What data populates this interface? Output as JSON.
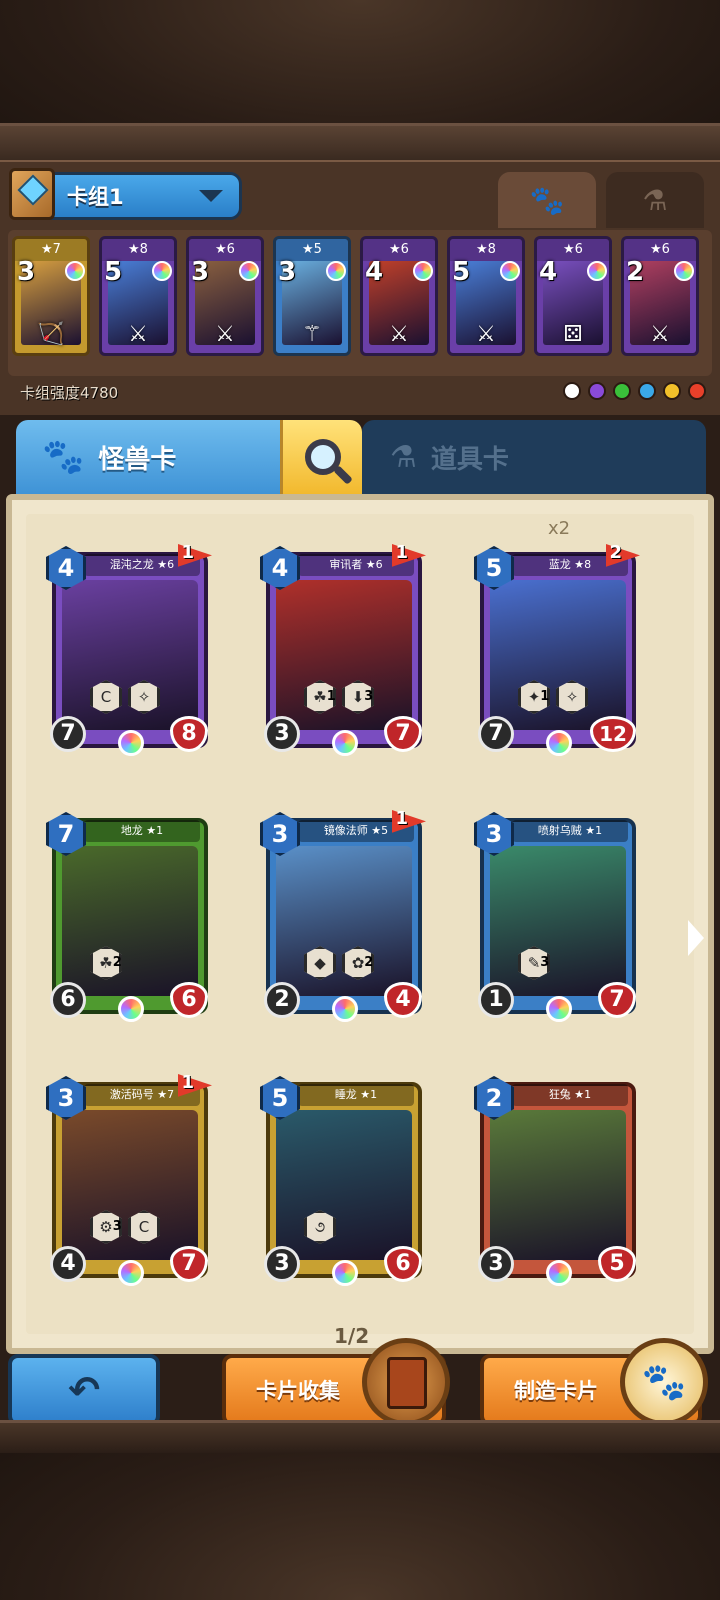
{
  "deck": {
    "name": "卡组1",
    "power_label": "卡组强度4780",
    "tabs": {
      "monster_icon": "paw-icon",
      "item_icon": "flask-icon"
    },
    "cards": [
      {
        "cost": "3",
        "stars": "★7",
        "frame": "gold",
        "bottom_icon": "bow-icon",
        "art": "#d8a040"
      },
      {
        "cost": "5",
        "stars": "★8",
        "frame": "purple",
        "bottom_icon": "sword-icon",
        "art": "#4a7fd8"
      },
      {
        "cost": "3",
        "stars": "★6",
        "frame": "purple",
        "bottom_icon": "sword-icon",
        "art": "#8a6040"
      },
      {
        "cost": "3",
        "stars": "★5",
        "frame": "blue",
        "bottom_icon": "staff-icon",
        "art": "#6ab0e0"
      },
      {
        "cost": "4",
        "stars": "★6",
        "frame": "purple",
        "bottom_icon": "sword-icon",
        "art": "#c0402a"
      },
      {
        "cost": "5",
        "stars": "★8",
        "frame": "purple",
        "bottom_icon": "sword-icon",
        "art": "#4a7fd8"
      },
      {
        "cost": "4",
        "stars": "★6",
        "frame": "purple",
        "bottom_icon": "dice-icon",
        "art": "#7a50c0"
      },
      {
        "cost": "2",
        "stars": "★6",
        "frame": "purple",
        "bottom_icon": "sword-icon",
        "art": "#b04060"
      }
    ],
    "element_colors": [
      "#ffffff",
      "#8a4ad8",
      "#3ac03a",
      "#3aa8e8",
      "#f2c02a",
      "#e8402a"
    ]
  },
  "tabs": {
    "monster": "怪兽卡",
    "item": "道具卡",
    "search_icon": "magnifier-icon"
  },
  "collection": {
    "copies_label": "x2",
    "page_indicator": "1/2",
    "cards": [
      {
        "name": "混沌之龙 ★6",
        "cost": "4",
        "flag": "1",
        "attack": "7",
        "hp": "8",
        "frame": "purple",
        "art": "#6a40a0",
        "abilities": [
          {
            "icon": "C",
            "num": ""
          },
          {
            "icon": "✧",
            "num": ""
          }
        ]
      },
      {
        "name": "审讯者 ★6",
        "cost": "4",
        "flag": "1",
        "attack": "3",
        "hp": "7",
        "frame": "purple",
        "art": "#b0302a",
        "abilities": [
          {
            "icon": "☘",
            "num": "1"
          },
          {
            "icon": "⬇",
            "num": "3"
          }
        ]
      },
      {
        "name": "蓝龙 ★8",
        "cost": "5",
        "flag": "2",
        "attack": "7",
        "hp": "12",
        "frame": "purple",
        "art": "#4a70d0",
        "abilities": [
          {
            "icon": "✦",
            "num": "1"
          },
          {
            "icon": "✧",
            "num": ""
          }
        ]
      },
      {
        "name": "地龙 ★1",
        "cost": "7",
        "flag": "",
        "attack": "6",
        "hp": "6",
        "frame": "green",
        "art": "#4a6a2a",
        "abilities": [
          {
            "icon": "☘",
            "num": "2"
          }
        ]
      },
      {
        "name": "镜像法师 ★5",
        "cost": "3",
        "flag": "1",
        "attack": "2",
        "hp": "4",
        "frame": "blue",
        "art": "#5a90c8",
        "abilities": [
          {
            "icon": "◆",
            "num": ""
          },
          {
            "icon": "✿",
            "num": "2"
          }
        ]
      },
      {
        "name": "喷射乌贼 ★1",
        "cost": "3",
        "flag": "",
        "attack": "1",
        "hp": "7",
        "frame": "blue",
        "art": "#3a8a6a",
        "abilities": [
          {
            "icon": "✎",
            "num": "3"
          }
        ]
      },
      {
        "name": "激活码号 ★7",
        "cost": "3",
        "flag": "1",
        "attack": "4",
        "hp": "7",
        "frame": "gold",
        "art": "#7a4a2a",
        "abilities": [
          {
            "icon": "⚙",
            "num": "3"
          },
          {
            "icon": "C",
            "num": ""
          }
        ]
      },
      {
        "name": "睡龙 ★1",
        "cost": "5",
        "flag": "",
        "attack": "3",
        "hp": "6",
        "frame": "gold",
        "art": "#2a5a6a",
        "abilities": [
          {
            "icon": "૭",
            "num": ""
          }
        ]
      },
      {
        "name": "狂兔 ★1",
        "cost": "2",
        "flag": "",
        "attack": "3",
        "hp": "5",
        "frame": "red",
        "art": "#5a7a3a",
        "abilities": []
      }
    ]
  },
  "buttons": {
    "back_icon": "back-arrow-icon",
    "collect": "卡片收集",
    "craft": "制造卡片"
  }
}
